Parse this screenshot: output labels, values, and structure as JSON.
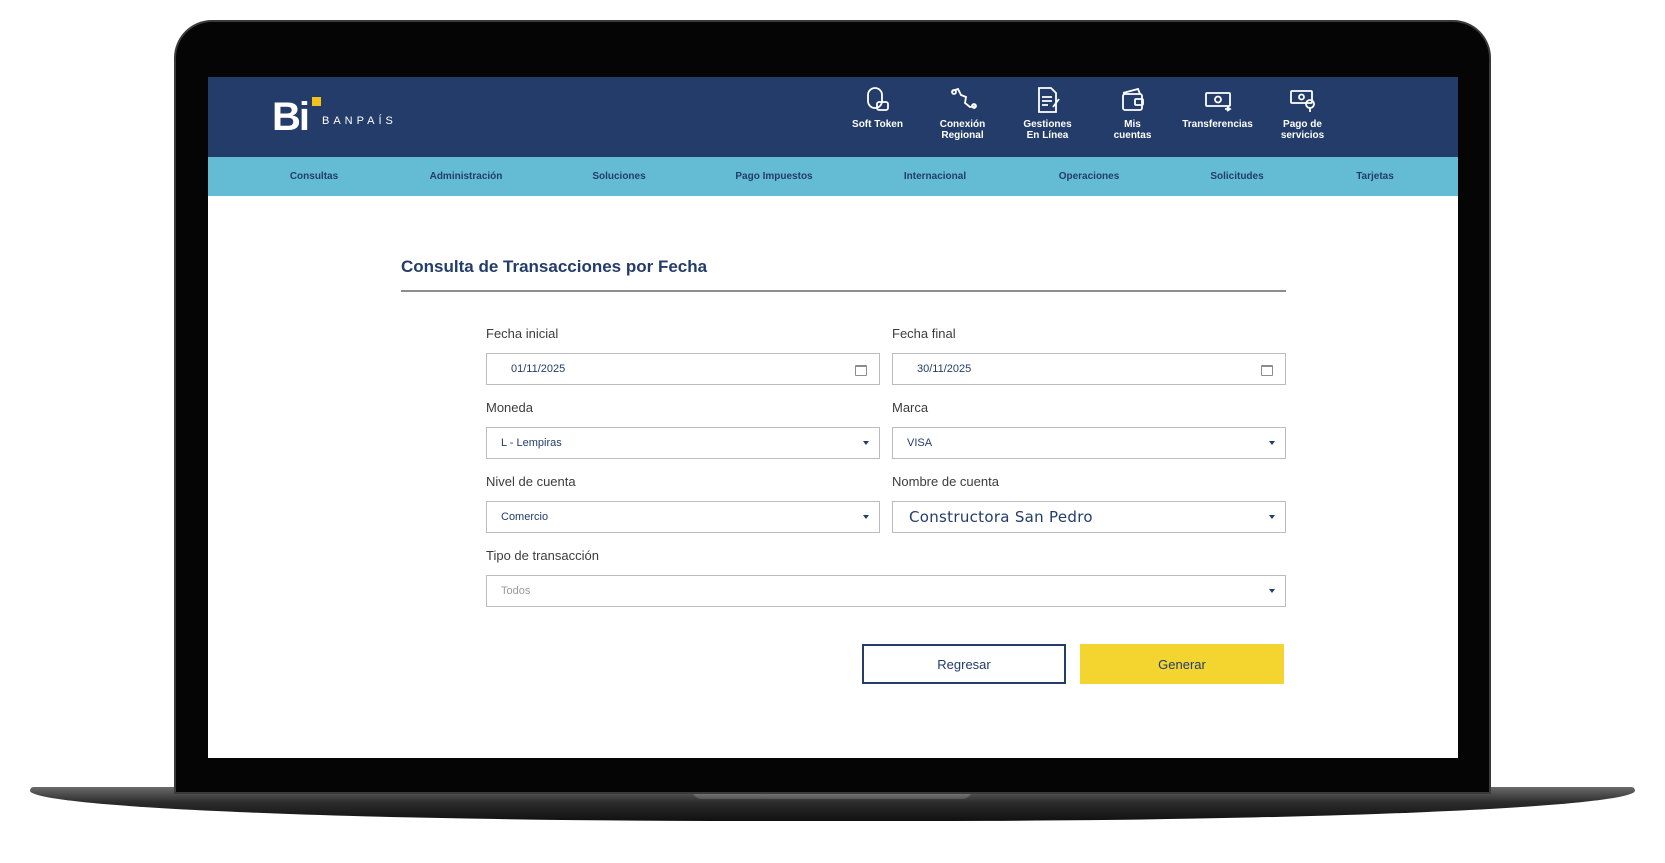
{
  "brand": {
    "logo_mark": "Bi",
    "logo_text": "BANPAÍS"
  },
  "tools": [
    {
      "label": "Soft Token",
      "icon": "soft-token-icon"
    },
    {
      "label": "Conexión\nRegional",
      "icon": "regional-connection-icon"
    },
    {
      "label": "Gestiones\nEn Línea",
      "icon": "online-management-icon"
    },
    {
      "label": "Mis\ncuentas",
      "icon": "wallet-icon"
    },
    {
      "label": "Transferencias",
      "icon": "transfer-money-icon"
    },
    {
      "label": "Pago de\nservicios",
      "icon": "service-payment-icon"
    }
  ],
  "menu": [
    "Consultas",
    "Administración",
    "Soluciones",
    "Pago Impuestos",
    "Internacional",
    "Operaciones",
    "Solicitudes",
    "Tarjetas"
  ],
  "page": {
    "title": "Consulta de Transacciones por Fecha"
  },
  "form": {
    "fecha_inicial": {
      "label": "Fecha inicial",
      "value": "01/11/2025"
    },
    "fecha_final": {
      "label": "Fecha final",
      "value": "30/11/2025"
    },
    "moneda": {
      "label": "Moneda",
      "value": "L - Lempiras"
    },
    "marca": {
      "label": "Marca",
      "value": "VISA"
    },
    "nivel_cuenta": {
      "label": "Nivel de cuenta",
      "value": "Comercio"
    },
    "nombre_cuenta": {
      "label": "Nombre de cuenta",
      "value": "Constructora San Pedro"
    },
    "tipo_transaccion": {
      "label": "Tipo de transacción",
      "placeholder": "Todos"
    }
  },
  "buttons": {
    "back": "Regresar",
    "generate": "Generar"
  },
  "colors": {
    "navy": "#233c6a",
    "menu_blue": "#63bcd4",
    "accent_yellow": "#f4d530",
    "logo_yellow": "#f2c21b"
  }
}
